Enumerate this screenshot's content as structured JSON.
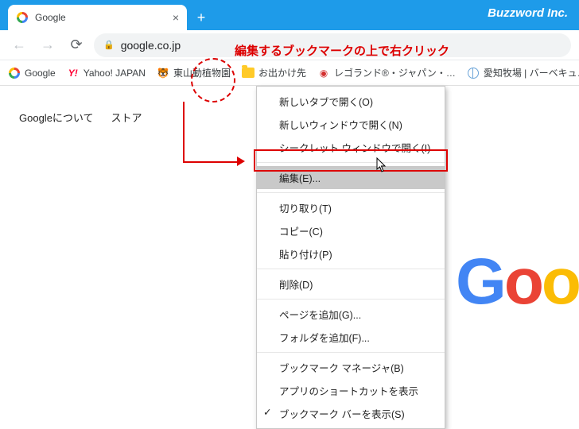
{
  "titlebar": {
    "tab_title": "Google",
    "brand": "Buzzword Inc."
  },
  "toolbar": {
    "url": "google.co.jp"
  },
  "bookmarks": {
    "items": [
      {
        "label": "Google"
      },
      {
        "label": "Yahoo! JAPAN"
      },
      {
        "label": "東山動植物園"
      },
      {
        "label": "お出かけ先"
      },
      {
        "label": "レゴランド®・ジャパン・…"
      },
      {
        "label": "愛知牧場 | バーベキュ…"
      }
    ]
  },
  "page": {
    "nav1": "Googleについて",
    "nav2": "ストア",
    "logo": [
      "G",
      "o",
      "o"
    ]
  },
  "annotation": "編集するブックマークの上で右クリック",
  "context_menu": {
    "open_tab": "新しいタブで開く(O)",
    "open_window": "新しいウィンドウで開く(N)",
    "open_incognito": "シークレット ウィンドウで開く(I)",
    "edit": "編集(E)...",
    "cut": "切り取り(T)",
    "copy": "コピー(C)",
    "paste": "貼り付け(P)",
    "delete": "削除(D)",
    "add_page": "ページを追加(G)...",
    "add_folder": "フォルダを追加(F)...",
    "manager": "ブックマーク マネージャ(B)",
    "show_shortcut": "アプリのショートカットを表示",
    "show_bar": "ブックマーク バーを表示(S)"
  }
}
